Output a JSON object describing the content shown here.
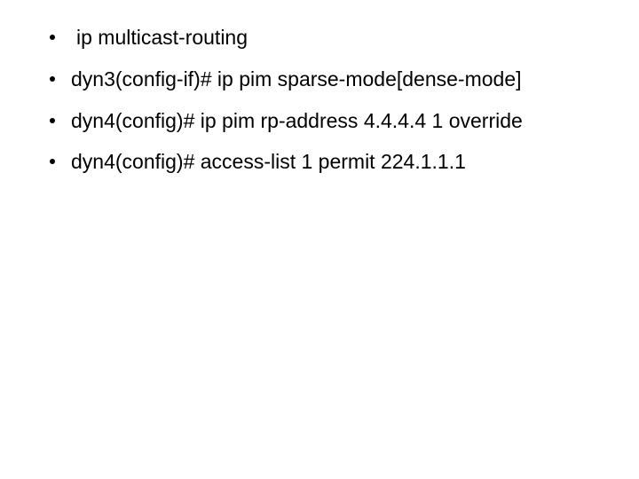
{
  "bullets": [
    " ip multicast-routing",
    "dyn3(config-if)# ip pim sparse-mode[dense-mode]",
    "dyn4(config)# ip pim rp-address 4.4.4.4 1 override",
    "dyn4(config)# access-list 1 permit 224.1.1.1"
  ]
}
